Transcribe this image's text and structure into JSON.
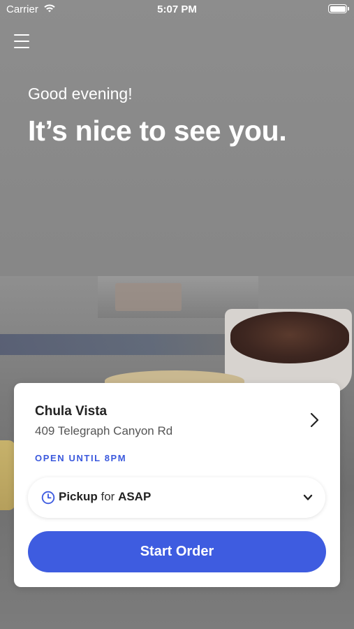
{
  "status_bar": {
    "carrier": "Carrier",
    "time": "5:07 PM"
  },
  "header": {
    "menu_icon": "hamburger-menu-icon"
  },
  "hero": {
    "greeting": "Good evening!",
    "headline": "It’s nice to see you."
  },
  "store_card": {
    "name": "Chula Vista",
    "address": "409 Telegraph Canyon Rd",
    "hours": "OPEN UNTIL 8PM",
    "order_type": "Pickup",
    "for_word": "for",
    "time_choice": "ASAP",
    "start_button": "Start Order"
  },
  "colors": {
    "accent": "#3e5ce0",
    "hours_text": "#3b59dd",
    "background_overlay": "#878787"
  }
}
